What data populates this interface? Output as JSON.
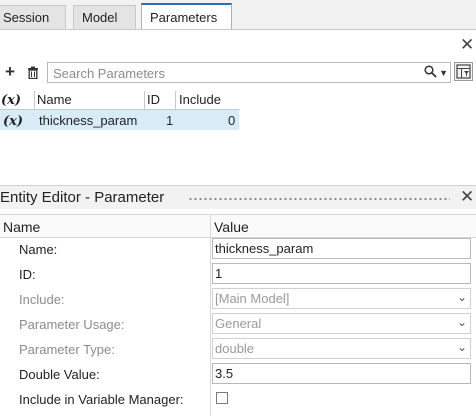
{
  "tabs": [
    {
      "label": "Session",
      "active": false
    },
    {
      "label": "Model",
      "active": false
    },
    {
      "label": "Parameters",
      "active": true
    }
  ],
  "toolbar": {
    "add_icon": "plus-icon",
    "delete_icon": "trash-icon",
    "search_placeholder": "Search Parameters",
    "search_icon": "magnifier-icon",
    "filter_icon": "column-filter-icon"
  },
  "param_table": {
    "columns": [
      "(x)",
      "Name",
      "ID",
      "Include"
    ],
    "rows": [
      {
        "icon": "(x)",
        "name": "thickness_param",
        "id": "1",
        "include": "0"
      }
    ]
  },
  "entity_editor": {
    "title": "Entity Editor - Parameter",
    "columns": {
      "name": "Name",
      "value": "Value"
    },
    "fields": [
      {
        "label": "Name:",
        "value": "thickness_param",
        "kind": "text",
        "enabled": true
      },
      {
        "label": "ID:",
        "value": "1",
        "kind": "text",
        "enabled": true
      },
      {
        "label": "Include:",
        "value": "[Main Model]",
        "kind": "select",
        "enabled": false
      },
      {
        "label": "Parameter Usage:",
        "value": "General",
        "kind": "select",
        "enabled": false
      },
      {
        "label": "Parameter Type:",
        "value": "double",
        "kind": "select",
        "enabled": false
      },
      {
        "label": "Double Value:",
        "value": "3.5",
        "kind": "text",
        "enabled": true
      },
      {
        "label": "Include in Variable Manager:",
        "value": "",
        "kind": "checkbox",
        "checked": false,
        "enabled": true
      }
    ]
  },
  "colors": {
    "active_tab_accent": "#2a6db5",
    "selected_row": "#d8ecf8"
  }
}
